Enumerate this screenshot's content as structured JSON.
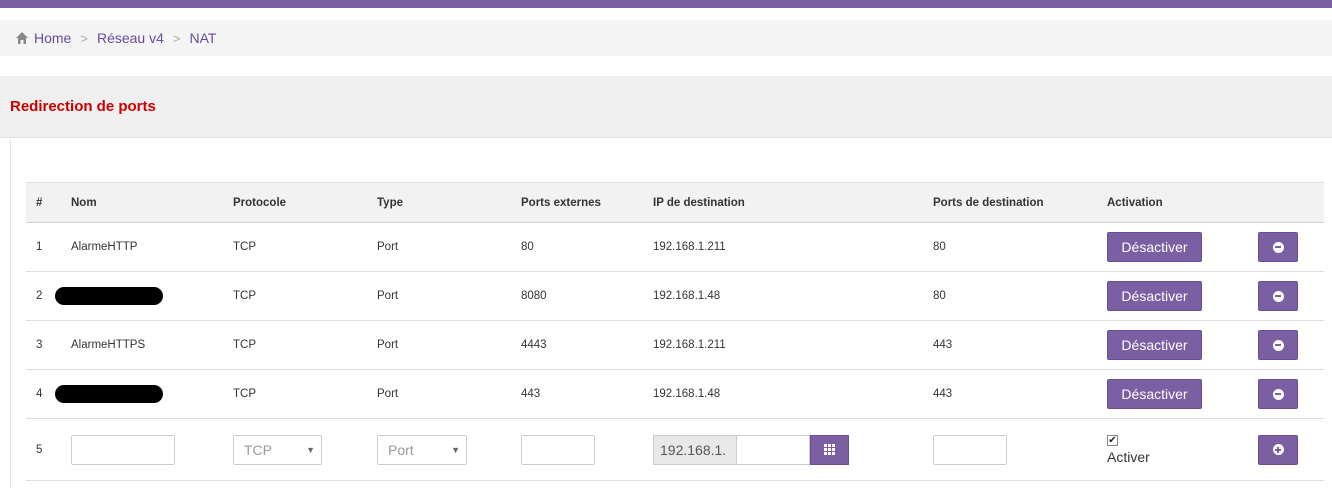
{
  "breadcrumb": {
    "home": "Home",
    "sep": ">",
    "section": "Réseau v4",
    "page": "NAT"
  },
  "panel": {
    "title": "Redirection de ports"
  },
  "table": {
    "headers": [
      "#",
      "Nom",
      "Protocole",
      "Type",
      "Ports externes",
      "IP de destination",
      "Ports de destination",
      "Activation"
    ],
    "rows": [
      {
        "num": "1",
        "nom": "AlarmeHTTP",
        "protocole": "TCP",
        "type": "Port",
        "ext": "80",
        "ip": "192.168.1.211",
        "dest": "80",
        "action": "Désactiver"
      },
      {
        "num": "2",
        "nom": "",
        "protocole": "TCP",
        "type": "Port",
        "ext": "8080",
        "ip": "192.168.1.48",
        "dest": "80",
        "action": "Désactiver"
      },
      {
        "num": "3",
        "nom": "AlarmeHTTPS",
        "protocole": "TCP",
        "type": "Port",
        "ext": "4443",
        "ip": "192.168.1.211",
        "dest": "443",
        "action": "Désactiver"
      },
      {
        "num": "4",
        "nom": "",
        "protocole": "TCP",
        "type": "Port",
        "ext": "443",
        "ip": "192.168.1.48",
        "dest": "443",
        "action": "Désactiver"
      }
    ],
    "new_row": {
      "num": "5",
      "protocole_selected": "TCP",
      "type_selected": "Port",
      "ip_prefix": "192.168.1.",
      "activer_label": "Activer",
      "activer_checked": true
    }
  },
  "colors": {
    "accent": "#7a5fa3",
    "title_red": "#cc0000",
    "breadcrumb_link": "#6a4a9c"
  },
  "icons": {
    "home": "home-icon",
    "remove": "minus-circle-icon",
    "add": "plus-circle-icon",
    "grid": "grid-icon"
  }
}
